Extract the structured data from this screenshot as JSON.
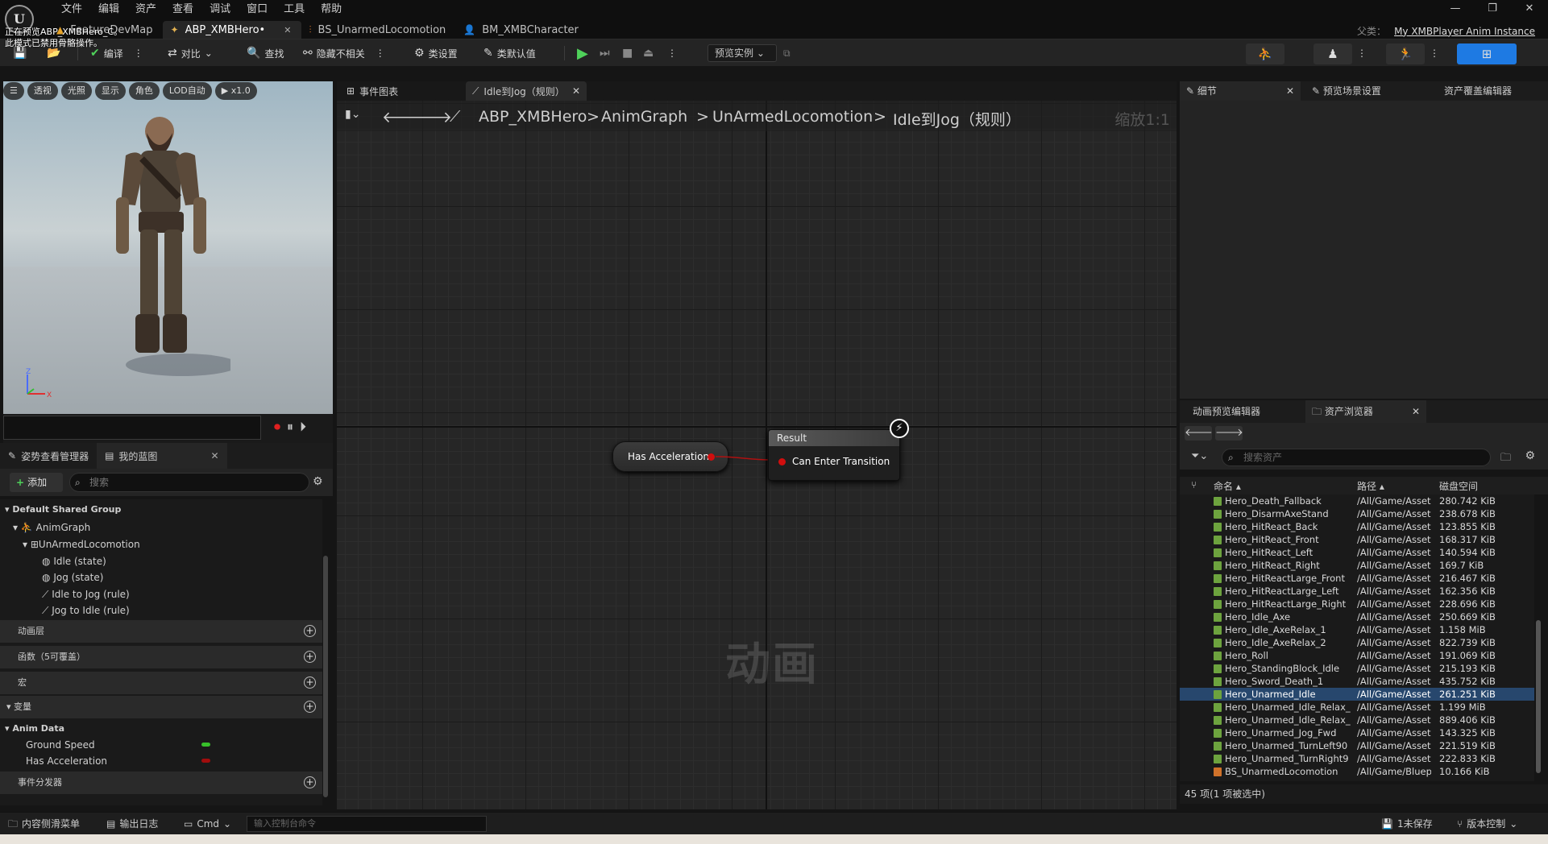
{
  "menu": [
    "文件",
    "编辑",
    "资产",
    "查看",
    "调试",
    "窗口",
    "工具",
    "帮助"
  ],
  "window_controls": [
    "—",
    "❐",
    "✕"
  ],
  "doc_tabs": [
    {
      "label": "FeatureDevMap"
    },
    {
      "label": "ABP_XMBHero•"
    },
    {
      "label": "BS_UnarmedLocomotion"
    },
    {
      "label": "BM_XMBCharacter"
    }
  ],
  "parent_class": {
    "label": "父类：",
    "value": "My XMBPlayer Anim Instance"
  },
  "toolbar": {
    "compile": "编译",
    "diff": "对比",
    "find": "查找",
    "hide_unrelated": "隐藏不相关",
    "class_settings": "类设置",
    "class_defaults": "类默认值",
    "preview_instance": "预览实例"
  },
  "viewport": {
    "buttons": [
      "透视",
      "光照",
      "显示",
      "角色",
      "LOD自动",
      "x1.0"
    ],
    "notice_line1": "正在预览ABP_XMBHero_C。",
    "notice_line2": "此模式已禁用骨骼操作。",
    "axis_z": "Z",
    "axis_x": "X"
  },
  "left_tabs": {
    "pose_watch": "姿势查看管理器",
    "my_blueprint": "我的蓝图"
  },
  "mybp": {
    "add_label": "添加",
    "search_placeholder": "搜索",
    "group": "Default Shared Group",
    "anim_graph": "AnimGraph",
    "state_machine": "UnArmedLocomotion",
    "items": [
      "Idle (state)",
      "Jog (state)",
      "Idle to Jog (rule)",
      "Jog to Idle (rule)"
    ],
    "sections": [
      "动画层",
      "函数（5可覆盖）",
      "宏",
      "变量",
      "事件分发器"
    ],
    "var_category": "Anim Data",
    "variables": [
      {
        "name": "Ground Speed",
        "color": "#37c02a"
      },
      {
        "name": "Has Acceleration",
        "color": "#a10d0d"
      }
    ]
  },
  "graph": {
    "tabs": [
      "事件图表",
      "Idle到Jog（规则）"
    ],
    "breadcrumb": [
      "ABP_XMBHero",
      "AnimGraph",
      "UnArmedLocomotion",
      "Idle到Jog（规则）"
    ],
    "zoom": "缩放1:1",
    "watermark": "动画",
    "node_variable": "Has Acceleration",
    "result_title": "Result",
    "result_pin": "Can Enter Transition"
  },
  "right_tabs": {
    "details": "细节",
    "preview_scene": "预览场景设置",
    "asset_override": "资产覆盖编辑器"
  },
  "content_browser": {
    "tab_anim_preview": "动画预览编辑器",
    "tab_asset_browser": "资产浏览器",
    "search_placeholder": "搜索资产",
    "col_name": "命名",
    "col_path": "路径",
    "col_size": "磁盘空间",
    "assets": [
      {
        "name": "Hero_Death_Fallback",
        "path": "/All/Game/Assets",
        "size": "280.742 KiB"
      },
      {
        "name": "Hero_DisarmAxeStand",
        "path": "/All/Game/Assets",
        "size": "238.678 KiB"
      },
      {
        "name": "Hero_HitReact_Back",
        "path": "/All/Game/Assets",
        "size": "123.855 KiB"
      },
      {
        "name": "Hero_HitReact_Front",
        "path": "/All/Game/Assets",
        "size": "168.317 KiB"
      },
      {
        "name": "Hero_HitReact_Left",
        "path": "/All/Game/Assets",
        "size": "140.594 KiB"
      },
      {
        "name": "Hero_HitReact_Right",
        "path": "/All/Game/Assets",
        "size": "169.7 KiB"
      },
      {
        "name": "Hero_HitReactLarge_Front",
        "path": "/All/Game/Assets",
        "size": "216.467 KiB"
      },
      {
        "name": "Hero_HitReactLarge_Left",
        "path": "/All/Game/Assets",
        "size": "162.356 KiB"
      },
      {
        "name": "Hero_HitReactLarge_Right",
        "path": "/All/Game/Assets",
        "size": "228.696 KiB"
      },
      {
        "name": "Hero_Idle_Axe",
        "path": "/All/Game/Assets",
        "size": "250.669 KiB"
      },
      {
        "name": "Hero_Idle_AxeRelax_1",
        "path": "/All/Game/Assets",
        "size": "1.158 MiB"
      },
      {
        "name": "Hero_Idle_AxeRelax_2",
        "path": "/All/Game/Assets",
        "size": "822.739 KiB"
      },
      {
        "name": "Hero_Roll",
        "path": "/All/Game/Assets",
        "size": "191.069 KiB"
      },
      {
        "name": "Hero_StandingBlock_Idle",
        "path": "/All/Game/Assets",
        "size": "215.193 KiB"
      },
      {
        "name": "Hero_Sword_Death_1",
        "path": "/All/Game/Assets",
        "size": "435.752 KiB"
      },
      {
        "name": "Hero_Unarmed_Idle",
        "path": "/All/Game/Assets",
        "size": "261.251 KiB",
        "selected": true
      },
      {
        "name": "Hero_Unarmed_Idle_Relax_",
        "path": "/All/Game/Assets",
        "size": "1.199 MiB"
      },
      {
        "name": "Hero_Unarmed_Idle_Relax_",
        "path": "/All/Game/Assets",
        "size": "889.406 KiB"
      },
      {
        "name": "Hero_Unarmed_Jog_Fwd",
        "path": "/All/Game/Assets",
        "size": "143.325 KiB"
      },
      {
        "name": "Hero_Unarmed_TurnLeft90",
        "path": "/All/Game/Assets",
        "size": "221.519 KiB"
      },
      {
        "name": "Hero_Unarmed_TurnRight9",
        "path": "/All/Game/Assets",
        "size": "222.833 KiB"
      },
      {
        "name": "BS_UnarmedLocomotion",
        "path": "/All/Game/Blueprints",
        "size": "10.166 KiB",
        "type": "blendspace"
      }
    ],
    "footer": "45 项(1 项被选中)"
  },
  "statusbar": {
    "content_drawer": "内容侧滑菜单",
    "output_log": "输出日志",
    "cmd": "Cmd",
    "console_placeholder": "输入控制台命令",
    "unsaved": "1未保存",
    "source_control": "版本控制"
  }
}
